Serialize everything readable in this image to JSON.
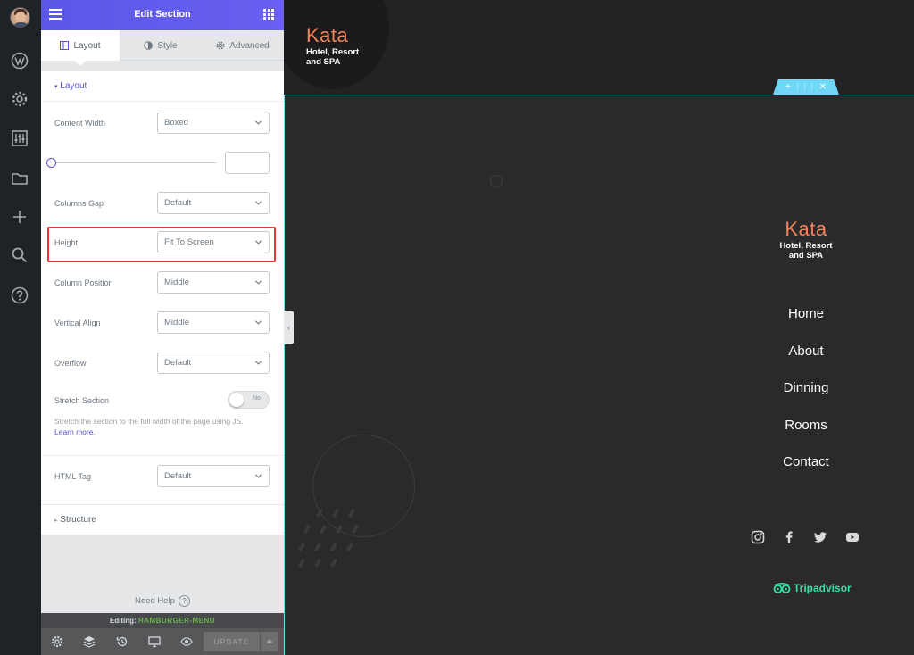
{
  "panel": {
    "title": "Edit Section",
    "tabs": [
      {
        "label": "Layout",
        "icon": "columns-icon"
      },
      {
        "label": "Style",
        "icon": "half-circle-icon"
      },
      {
        "label": "Advanced",
        "icon": "gear-icon"
      }
    ],
    "layout_section": {
      "title": "Layout",
      "controls": {
        "content_width": {
          "label": "Content Width",
          "value": "Boxed"
        },
        "columns_gap": {
          "label": "Columns Gap",
          "value": "Default"
        },
        "height": {
          "label": "Height",
          "value": "Fit To Screen"
        },
        "column_position": {
          "label": "Column Position",
          "value": "Middle"
        },
        "vertical_align": {
          "label": "Vertical Align",
          "value": "Middle"
        },
        "overflow": {
          "label": "Overflow",
          "value": "Default"
        },
        "stretch_section": {
          "label": "Stretch Section",
          "toggle": "No",
          "description": "Stretch the section to the full width of the page using JS.",
          "link": "Learn more."
        },
        "html_tag": {
          "label": "HTML Tag",
          "value": "Default"
        }
      }
    },
    "structure_section": {
      "title": "Structure"
    },
    "help": {
      "label": "Need Help",
      "icon": "question-icon"
    },
    "editing": {
      "prefix": "Editing:",
      "template": "HAMBURGER-MENU"
    },
    "footer": {
      "update_label": "UPDATE"
    },
    "highlight_color": "#e03a3a",
    "accent_color": "#5a55d8"
  },
  "site": {
    "logo": {
      "name": "Kata",
      "subtitle_line1": "Hotel, Resort",
      "subtitle_line2": "and SPA"
    },
    "menu": [
      "Home",
      "About",
      "Dinning",
      "Rooms",
      "Contact"
    ],
    "social_icons": [
      "instagram-icon",
      "facebook-icon",
      "twitter-icon",
      "youtube-icon"
    ],
    "tripadvisor": "Tripadvisor",
    "logo_color": "#f0855b",
    "section_border_color": "#71d7f7"
  }
}
